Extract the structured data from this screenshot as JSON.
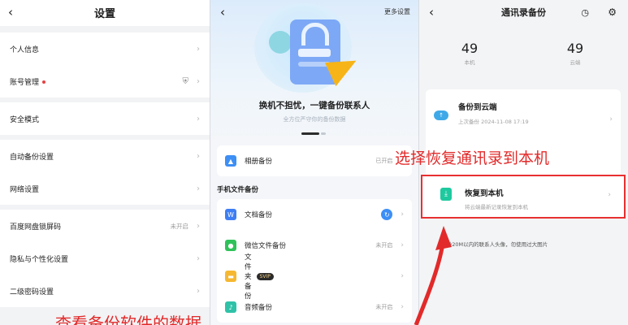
{
  "left_panel": {
    "title": "设置",
    "back_icon": "back-icon",
    "groups": [
      [
        {
          "label": "个人信息",
          "value": ""
        },
        {
          "label": "账号管理",
          "value": "",
          "dot": true,
          "extra_icon": "shield-icon"
        }
      ],
      [
        {
          "label": "安全模式",
          "value": ""
        }
      ],
      [
        {
          "label": "自动备份设置",
          "value": ""
        },
        {
          "label": "网络设置",
          "value": ""
        }
      ],
      [
        {
          "label": "百度网盘锁屏码",
          "value": "未开启"
        },
        {
          "label": "隐私与个性化设置",
          "value": ""
        },
        {
          "label": "二级密码设置",
          "value": ""
        }
      ]
    ]
  },
  "middle_panel": {
    "more": "更多设置",
    "hero_title": "换机不担忧，一键备份联系人",
    "hero_subtitle": "全方位严守你的备份数据",
    "album": {
      "label": "相册备份",
      "value": "已开启"
    },
    "section_title": "手机文件备份",
    "items": [
      {
        "label": "文档备份",
        "value": "",
        "sync": true,
        "color": "#3d7ef5"
      },
      {
        "label": "微信文件备份",
        "value": "未开启",
        "color": "#2fc25b"
      },
      {
        "label": "文件夹备份",
        "value": "",
        "badge": "SVIP",
        "color": "#f5b830"
      },
      {
        "label": "音频备份",
        "value": "未开启",
        "color": "#2fc2a8"
      }
    ]
  },
  "right_panel": {
    "title": "通讯录备份",
    "local_count": "49",
    "local_label": "本机",
    "cloud_count": "49",
    "cloud_label": "云端",
    "backup_title": "备份到云端",
    "backup_sub": "上次备份 2024-11-08 17:19",
    "restore_title": "恢复到本机",
    "restore_sub": "将云端最新记录恢复到本机",
    "note": "*备份20M以内的联系人头像，勿使用过大图片"
  },
  "annotations": {
    "right": "选择恢复通讯录到本机",
    "bottom": "查看备份软件的数据"
  }
}
